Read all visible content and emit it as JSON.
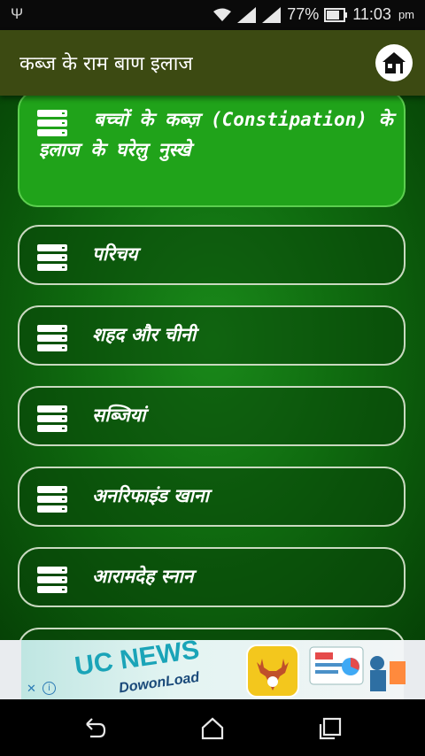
{
  "status": {
    "usb_icon": "usb-icon",
    "battery": "77%",
    "time": "11:03",
    "ampm": "pm"
  },
  "appbar": {
    "title": "कब्ज के राम बाण इलाज",
    "home_icon": "home-icon"
  },
  "menu": {
    "items": [
      {
        "label": "बच्चों के कब्ज़ (Constipation) के इलाज के घरेलु नुस्खे",
        "active": true
      },
      {
        "label": "परिचय"
      },
      {
        "label": "शहद और चीनी"
      },
      {
        "label": "सब्जियां"
      },
      {
        "label": "अनरिफाइंड खाना"
      },
      {
        "label": "आरामदेह स्नान"
      },
      {
        "label": ""
      }
    ]
  },
  "ad": {
    "headline": "UC NEWS",
    "sub": "DowonLoad",
    "close": "✕",
    "info": "i"
  },
  "colors": {
    "appbar": "#3c4a12",
    "active_card": "#20a31a",
    "background_green": "#0f6a0f"
  }
}
